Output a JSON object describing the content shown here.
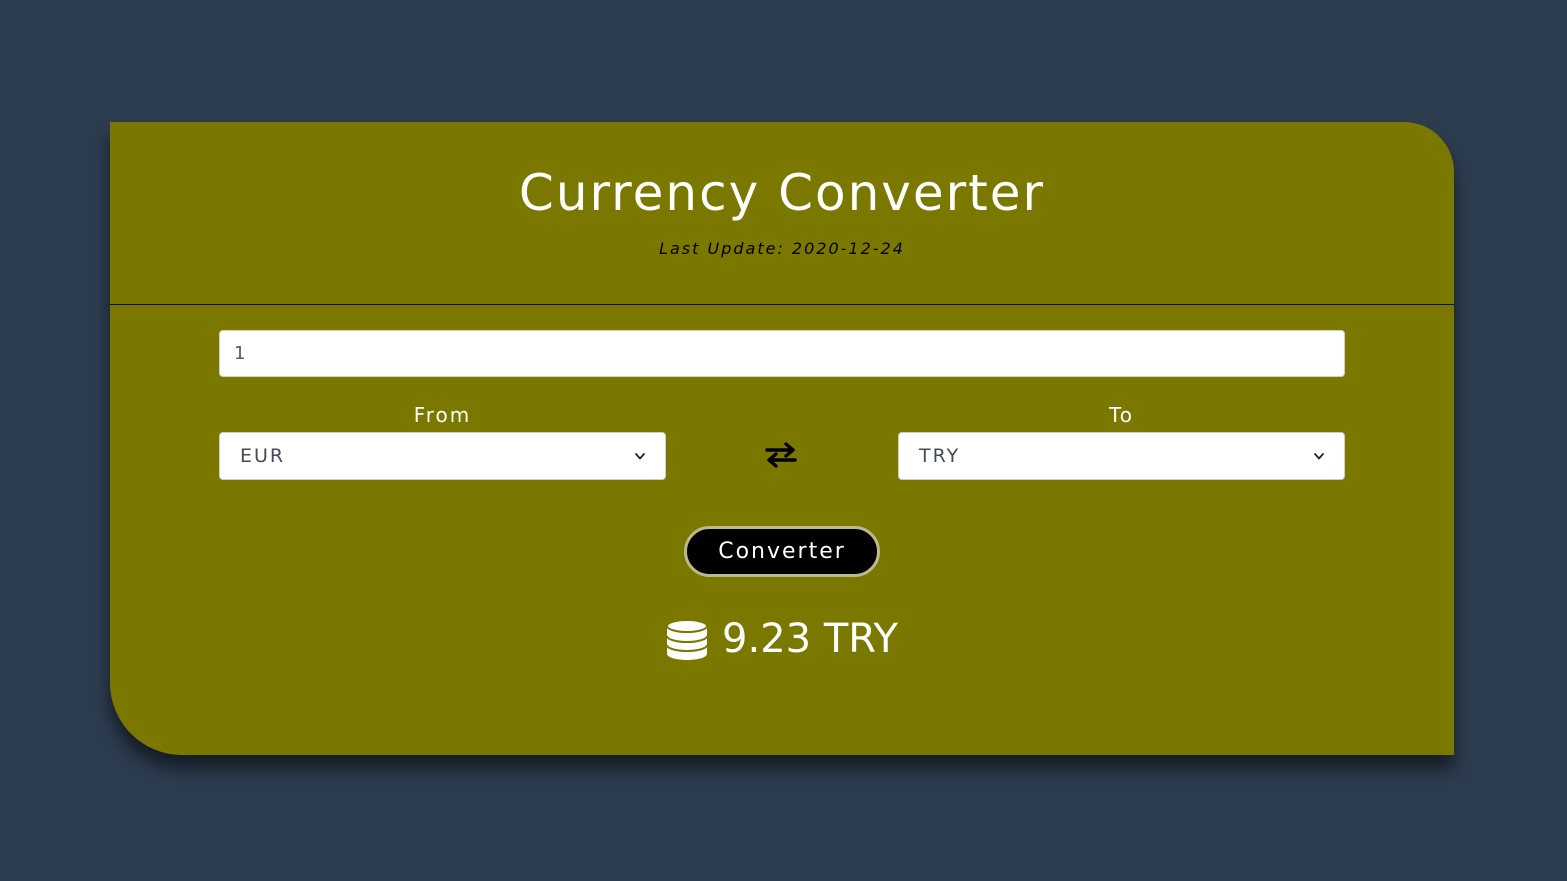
{
  "header": {
    "title": "Currency Converter",
    "last_update": "Last Update: 2020-12-24"
  },
  "form": {
    "amount_value": "1",
    "from_label": "From",
    "from_selected": "EUR",
    "to_label": "To",
    "to_selected": "TRY",
    "convert_label": "Converter"
  },
  "result": {
    "text": "9.23 TRY",
    "icon": "coins-icon"
  },
  "colors": {
    "background": "#2d3d50",
    "card": "#7b7800",
    "button": "#000000",
    "button_border": "#bdb88f"
  }
}
